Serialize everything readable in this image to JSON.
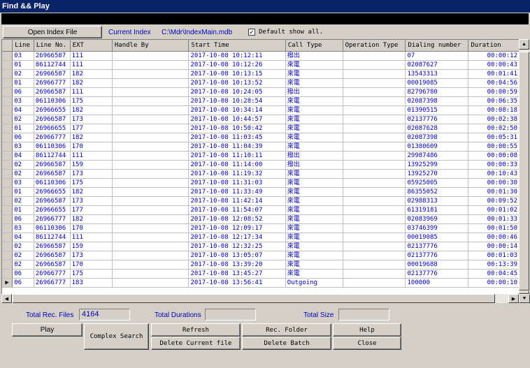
{
  "window": {
    "title": "Find && Play"
  },
  "top": {
    "open_index_label": "Open Index File",
    "current_index_label": "Current Index",
    "current_index_path": "C:\\Mdr\\IndexMain.mdb",
    "default_show_all_label": "Default show all.",
    "default_show_all_checked": "✓"
  },
  "table": {
    "columns": [
      "Line",
      "Line No.",
      "EXT",
      "Handle By",
      "Start Time",
      "Call Type",
      "Operation Type",
      "Dialing number",
      "Duration"
    ],
    "rows": [
      [
        "03",
        "26966587",
        "111",
        "",
        "2017-10-08 10:12:11",
        "撥出",
        "",
        "07",
        "00:00:12"
      ],
      [
        "01",
        "86112744",
        "111",
        "",
        "2017-10-08 10:12:26",
        "來電",
        "",
        "02087627",
        "00:00:43"
      ],
      [
        "02",
        "26966587",
        "182",
        "",
        "2017-10-08 10:13:15",
        "來電",
        "",
        "13543313",
        "00:01:41"
      ],
      [
        "01",
        "26966777",
        "182",
        "",
        "2017-10-08 10:13:52",
        "來電",
        "",
        "00019085",
        "00:04:56"
      ],
      [
        "06",
        "26966587",
        "111",
        "",
        "2017-10-08 10:24:05",
        "撥出",
        "",
        "82796780",
        "00:00:59"
      ],
      [
        "03",
        "06110306",
        "175",
        "",
        "2017-10-08 10:28:54",
        "來電",
        "",
        "02087398",
        "00:06:35"
      ],
      [
        "04",
        "26966655",
        "182",
        "",
        "2017-10-08 10:34:14",
        "來電",
        "",
        "01390515",
        "00:08:18"
      ],
      [
        "02",
        "26966587",
        "173",
        "",
        "2017-10-08 10:44:57",
        "來電",
        "",
        "02137776",
        "00:02:38"
      ],
      [
        "01",
        "26966655",
        "177",
        "",
        "2017-10-08 10:50:42",
        "來電",
        "",
        "02087628",
        "00:02:50"
      ],
      [
        "06",
        "26966777",
        "182",
        "",
        "2017-10-08 11:03:45",
        "來電",
        "",
        "02087398",
        "00:05:31"
      ],
      [
        "03",
        "06110306",
        "170",
        "",
        "2017-10-08 11:04:39",
        "來電",
        "",
        "01380609",
        "00:00:55"
      ],
      [
        "04",
        "86112744",
        "111",
        "",
        "2017-10-08 11:10:11",
        "撥出",
        "",
        "29987486",
        "00:00:08"
      ],
      [
        "02",
        "26966587",
        "159",
        "",
        "2017-10-08 11:14:00",
        "撥出",
        "",
        "13925299",
        "00:00:33"
      ],
      [
        "02",
        "26966587",
        "173",
        "",
        "2017-10-08 11:19:32",
        "來電",
        "",
        "13925270",
        "00:10:43"
      ],
      [
        "03",
        "06110306",
        "175",
        "",
        "2017-10-08 11:31:03",
        "來電",
        "",
        "05925005",
        "00:00:30"
      ],
      [
        "01",
        "26966655",
        "182",
        "",
        "2017-10-08 11:33:49",
        "來電",
        "",
        "86355052",
        "00:01:30"
      ],
      [
        "02",
        "26966587",
        "173",
        "",
        "2017-10-08 11:42:14",
        "來電",
        "",
        "02988313",
        "00:09:52"
      ],
      [
        "01",
        "26966655",
        "177",
        "",
        "2017-10-08 11:54:07",
        "來電",
        "",
        "61319181",
        "00:01:02"
      ],
      [
        "06",
        "26966777",
        "182",
        "",
        "2017-10-08 12:08:52",
        "來電",
        "",
        "02083969",
        "00:01:33"
      ],
      [
        "03",
        "06110306",
        "170",
        "",
        "2017-10-08 12:09:17",
        "來電",
        "",
        "03746399",
        "00:01:50"
      ],
      [
        "04",
        "86112744",
        "111",
        "",
        "2017-10-08 12:17:34",
        "來電",
        "",
        "00019085",
        "00:00:46"
      ],
      [
        "02",
        "26966587",
        "159",
        "",
        "2017-10-08 12:32:25",
        "來電",
        "",
        "02137776",
        "00:00:14"
      ],
      [
        "02",
        "26966587",
        "173",
        "",
        "2017-10-08 13:05:07",
        "來電",
        "",
        "02137776",
        "00:01:03"
      ],
      [
        "02",
        "26966587",
        "170",
        "",
        "2017-10-08 13:39:20",
        "來電",
        "",
        "00019688",
        "00:13:39"
      ],
      [
        "06",
        "26966777",
        "175",
        "",
        "2017-10-08 13:45:27",
        "來電",
        "",
        "02137776",
        "00:04:45"
      ],
      [
        "06",
        "26966777",
        "183",
        "",
        "2017-10-08 13:56:41",
        "Outgoing",
        "",
        "100000",
        "00:00:10"
      ]
    ],
    "current_row_marker": "▶"
  },
  "footer": {
    "total_rec_files_label": "Total Rec. Files",
    "total_rec_files_value": "4164",
    "total_durations_label": "Total Durations",
    "total_durations_value": "",
    "total_size_label": "Total Size",
    "total_size_value": ""
  },
  "buttons": {
    "play": "Play",
    "complex_search": "Complex Search",
    "refresh": "Refresh",
    "rec_folder": "Rec. Folder",
    "help": "Help",
    "delete_current": "Delete Current file",
    "delete_batch": "Delete Batch",
    "close": "Close"
  },
  "icons": {
    "scroll_up": "▲",
    "scroll_down": "▼",
    "scroll_left": "◀",
    "scroll_right": "▶"
  }
}
